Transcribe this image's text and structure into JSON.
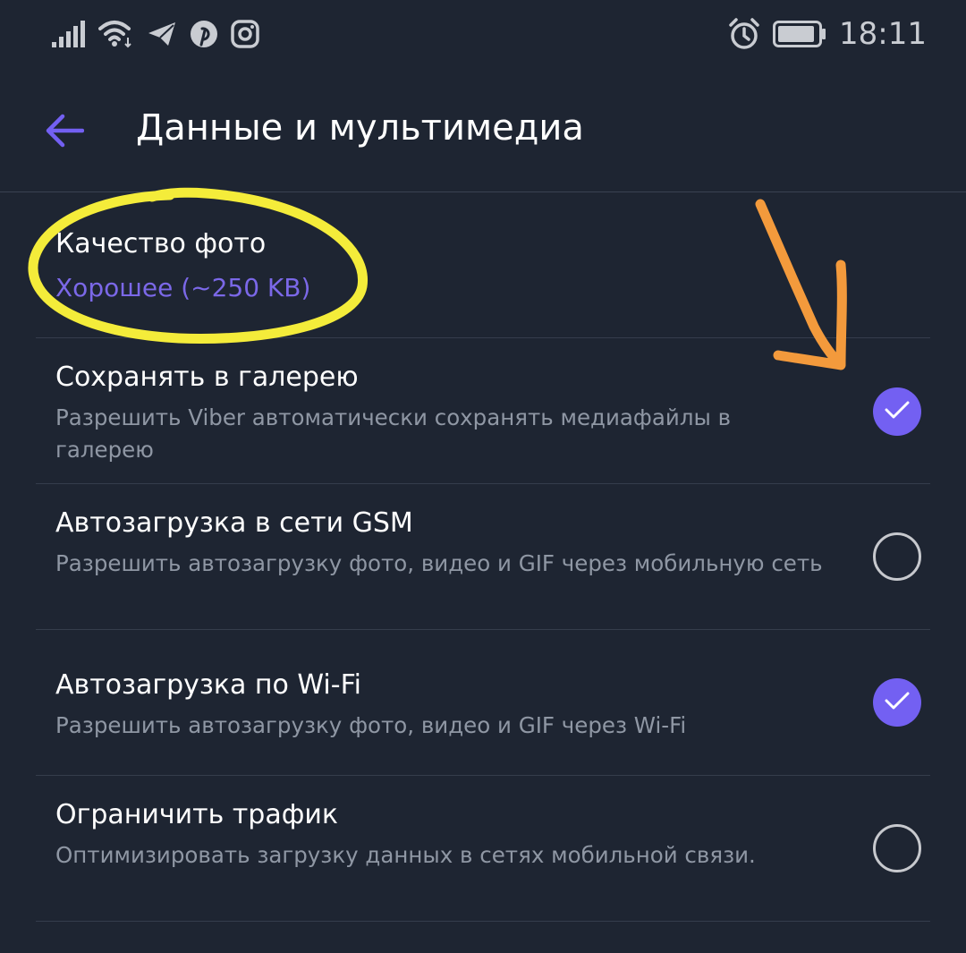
{
  "status_bar": {
    "time": "18:11"
  },
  "app_bar": {
    "title": "Данные и мультимедиа"
  },
  "settings": {
    "photo_quality": {
      "title": "Качество фото",
      "value": "Хорошее (~250 KB)"
    },
    "items": [
      {
        "title": "Сохранять в галерею",
        "subtitle": "Разрешить Viber автоматически сохранять медиафайлы в галерею",
        "checked": true
      },
      {
        "title": "Автозагрузка в сети GSM",
        "subtitle": "Разрешить автозагрузку фото, видео и GIF через мобильную сеть",
        "checked": false
      },
      {
        "title": "Автозагрузка по Wi-Fi",
        "subtitle": "Разрешить автозагрузку фото, видео и GIF через Wi-Fi",
        "checked": true
      },
      {
        "title": "Ограничить трафик",
        "subtitle": "Оптимизировать загрузку данных в сетях мобильной связи.",
        "checked": false
      }
    ]
  },
  "colors": {
    "background": "#1e2532",
    "accent": "#7360f2",
    "annotation_circle": "#f4ec3a",
    "annotation_arrow": "#f39a3c"
  }
}
